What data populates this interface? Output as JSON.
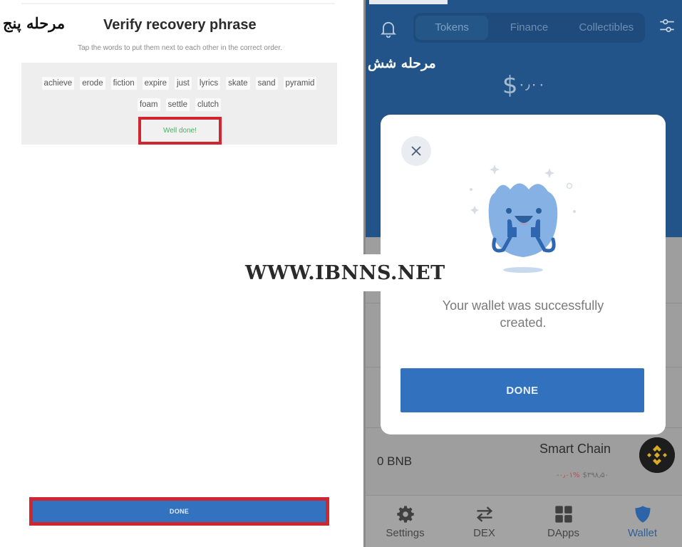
{
  "left_panel": {
    "step_label": "مرحله پنج",
    "title": "Verify recovery phrase",
    "subtitle": "Tap the words to put them next to each other in the correct order.",
    "words_row1": [
      "achieve",
      "erode",
      "fiction",
      "expire",
      "just",
      "lyrics",
      "skate",
      "sand",
      "pyramid"
    ],
    "words_row2": [
      "foam",
      "settle",
      "clutch"
    ],
    "status": "Well done!",
    "done_button": "DONE",
    "highlight_color": "#d0262f"
  },
  "right_panel": {
    "step_label": "مرحله شش",
    "tabs": [
      {
        "label": "Tokens",
        "active": true
      },
      {
        "label": "Finance",
        "active": false
      },
      {
        "label": "Collectibles",
        "active": false
      }
    ],
    "icons": {
      "left": "bell-icon",
      "right": "filter-sliders-icon"
    },
    "balance_symbol": "$",
    "balance_value": "۰٫۰۰",
    "modal": {
      "close_icon": "close-icon",
      "illustration": "happy-shield-mascot-thumbs-up",
      "message": "Your wallet was successfully created.",
      "done_button": "DONE"
    },
    "token_row": {
      "amount": "0 BNB",
      "name": "Smart Chain",
      "change": "-۰٫۰۱%",
      "price": "$۳۹۸٫۵۰",
      "logo": "binance-logo-icon"
    },
    "bottom_nav": [
      {
        "label": "Settings",
        "icon": "gear-icon",
        "active": false
      },
      {
        "label": "DEX",
        "icon": "swap-arrows-icon",
        "active": false
      },
      {
        "label": "DApps",
        "icon": "grid-icon",
        "active": false
      },
      {
        "label": "Wallet",
        "icon": "shield-icon",
        "active": true
      }
    ],
    "accent_color": "#3271bd",
    "header_color": "#22548a"
  },
  "watermark": "WWW.IBNNS.NET"
}
